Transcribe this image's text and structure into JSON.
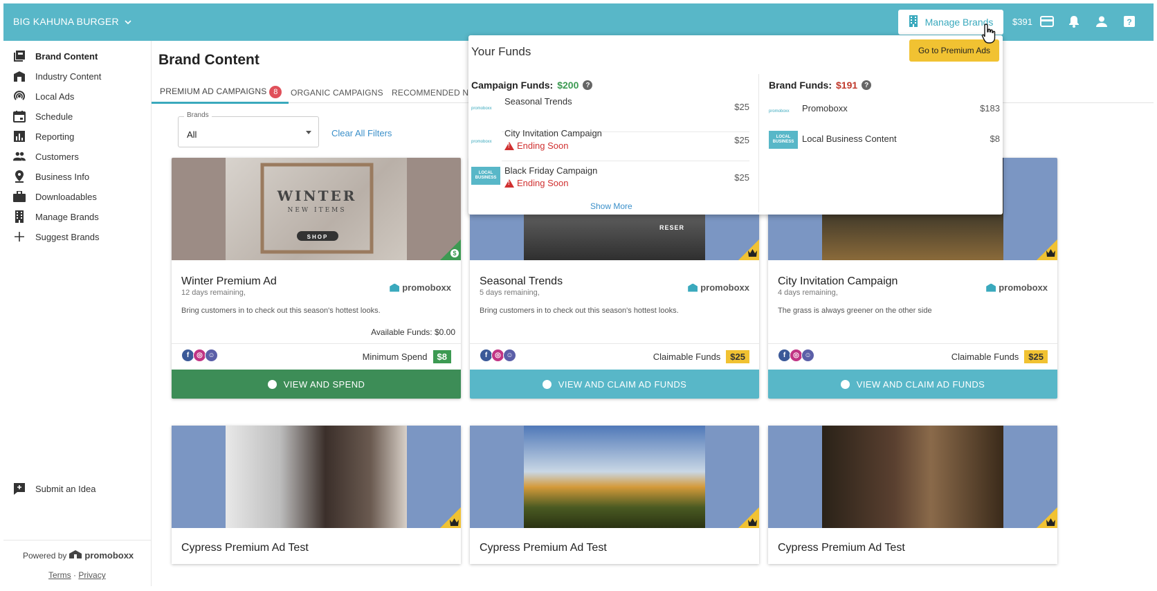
{
  "topbar": {
    "brand_name": "BIG KAHUNA BURGER",
    "manage_brands": "Manage Brands",
    "funds_total": "$391",
    "icons": [
      "credit-card-icon",
      "bell-icon",
      "user-icon",
      "help-icon"
    ]
  },
  "sidebar": {
    "items": [
      {
        "label": "Brand Content",
        "icon": "brand-content-icon"
      },
      {
        "label": "Industry Content",
        "icon": "industry-icon"
      },
      {
        "label": "Local Ads",
        "icon": "local-ads-icon"
      },
      {
        "label": "Schedule",
        "icon": "calendar-icon"
      },
      {
        "label": "Reporting",
        "icon": "bar-chart-icon"
      },
      {
        "label": "Customers",
        "icon": "people-icon"
      },
      {
        "label": "Business Info",
        "icon": "location-pin-icon"
      },
      {
        "label": "Downloadables",
        "icon": "briefcase-icon"
      },
      {
        "label": "Manage Brands",
        "icon": "building-icon"
      },
      {
        "label": "Suggest Brands",
        "icon": "plus-icon"
      }
    ],
    "submit_idea": "Submit an Idea",
    "powered_by": "Powered by",
    "powered_logo": "promoboxx",
    "terms": "Terms",
    "separator": "·",
    "privacy": "Privacy"
  },
  "main": {
    "title": "Brand Content",
    "tabs": [
      {
        "label": "PREMIUM AD CAMPAIGNS",
        "badge": "8"
      },
      {
        "label": "ORGANIC CAMPAIGNS"
      },
      {
        "label": "RECOMMENDED NATIO"
      }
    ],
    "filter": {
      "label": "Brands",
      "value": "All",
      "clear": "Clear All Filters"
    }
  },
  "cards": [
    {
      "title": "Winter Premium Ad",
      "days": "12 days remaining,",
      "logo": "promoboxx",
      "desc": "Bring customers in to check out this season's hottest looks.",
      "available": "Available Funds: $0.00",
      "spend_label": "Minimum Spend",
      "spend_amount": "$8",
      "button": "VIEW AND SPEND",
      "corner_icon": "dollar-icon",
      "image_text": {
        "big": "WINTER",
        "sub": "NEW ITEMS",
        "shop": "SHOP"
      }
    },
    {
      "title": "Seasonal Trends",
      "days": "5 days remaining,",
      "logo": "promoboxx",
      "desc": "Bring customers in to check out this season's hottest looks.",
      "spend_label": "Claimable Funds",
      "spend_amount": "$25",
      "button": "VIEW AND CLAIM AD FUNDS",
      "corner_icon": "crown-icon",
      "image_text": {
        "sign": "RESER"
      }
    },
    {
      "title": "City Invitation Campaign",
      "days": "4 days remaining,",
      "logo": "promoboxx",
      "desc": "The grass is always greener on the other side",
      "spend_label": "Claimable Funds",
      "spend_amount": "$25",
      "button": "VIEW AND CLAIM AD FUNDS",
      "corner_icon": "crown-icon"
    }
  ],
  "cards_row2": [
    {
      "title": "Cypress Premium Ad Test"
    },
    {
      "title": "Cypress Premium Ad Test"
    },
    {
      "title": "Cypress Premium Ad Test"
    }
  ],
  "funds_dropdown": {
    "title": "Your Funds",
    "go_button": "Go to Premium Ads",
    "campaign_label": "Campaign Funds:",
    "campaign_amount": "$200",
    "brand_label": "Brand Funds:",
    "brand_amount": "$191",
    "campaign_rows": [
      {
        "name": "Seasonal Trends",
        "amount": "$25",
        "logo": "promoboxx"
      },
      {
        "name": "City Invitation Campaign",
        "amount": "$25",
        "warning": "Ending Soon",
        "logo": "promoboxx"
      },
      {
        "name": "Black Friday Campaign",
        "amount": "$25",
        "warning": "Ending Soon",
        "logo": "LOCAL BUSINESS"
      }
    ],
    "brand_rows": [
      {
        "name": "Promoboxx",
        "amount": "$183",
        "logo": "promoboxx"
      },
      {
        "name": "Local Business Content",
        "amount": "$8",
        "logo": "LOCAL BUSINESS"
      }
    ],
    "show_more": "Show More"
  },
  "colors": {
    "topbar": "#58b7c8",
    "accent_green": "#3c9a52",
    "accent_yellow": "#f1c232",
    "warning_red": "#d03030",
    "link_blue": "#3a8fc9"
  }
}
